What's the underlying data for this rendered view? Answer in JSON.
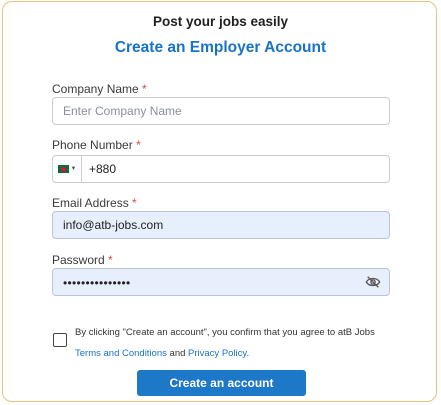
{
  "header": {
    "tagline": "Post your jobs easily",
    "title": "Create an Employer Account"
  },
  "form": {
    "company": {
      "label": "Company Name",
      "required_mark": "*",
      "placeholder": "Enter Company Name",
      "value": ""
    },
    "phone": {
      "label": "Phone Number",
      "required_mark": "*",
      "country_flag": "bangladesh-flag-icon",
      "value": "+880"
    },
    "email": {
      "label": "Email Address",
      "required_mark": "*",
      "value": "info@atb-jobs.com"
    },
    "password": {
      "label": "Password",
      "required_mark": "*",
      "masked_value": "•••••••••••••••",
      "toggle_icon": "eye-off-icon"
    }
  },
  "consent": {
    "checked": false,
    "text_before": "By clicking \"Create an account\", you confirm that you agree to atB Jobs ",
    "terms_link": "Terms and Conditions",
    "conjunction": " and ",
    "privacy_link": "Privacy Policy."
  },
  "submit_label": "Create an account",
  "colors": {
    "accent": "#1e78c8",
    "title": "#1873c7",
    "required": "#e0463b",
    "autofill_bg": "#e8effc",
    "card_border": "#e8c27a"
  }
}
